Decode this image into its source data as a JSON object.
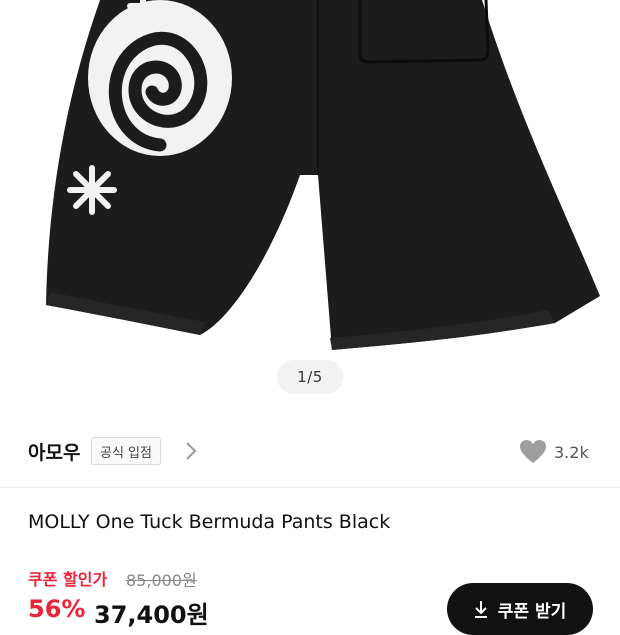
{
  "gallery": {
    "pager": "1/5"
  },
  "brand": {
    "name": "아모우",
    "badge": "공식 입점"
  },
  "likes": {
    "count": "3.2k"
  },
  "product": {
    "title": "MOLLY One Tuck Bermuda Pants Black"
  },
  "pricing": {
    "coupon_label": "쿠폰 할인가",
    "original_price": "85,000원",
    "discount": "56%",
    "final_price": "37,400원"
  },
  "coupon_button": {
    "label": "쿠폰 받기",
    "icon": "download-arrow-icon"
  },
  "colors": {
    "accent_red": "#e8263a",
    "button_black": "#111111",
    "text_dark": "#111111"
  }
}
